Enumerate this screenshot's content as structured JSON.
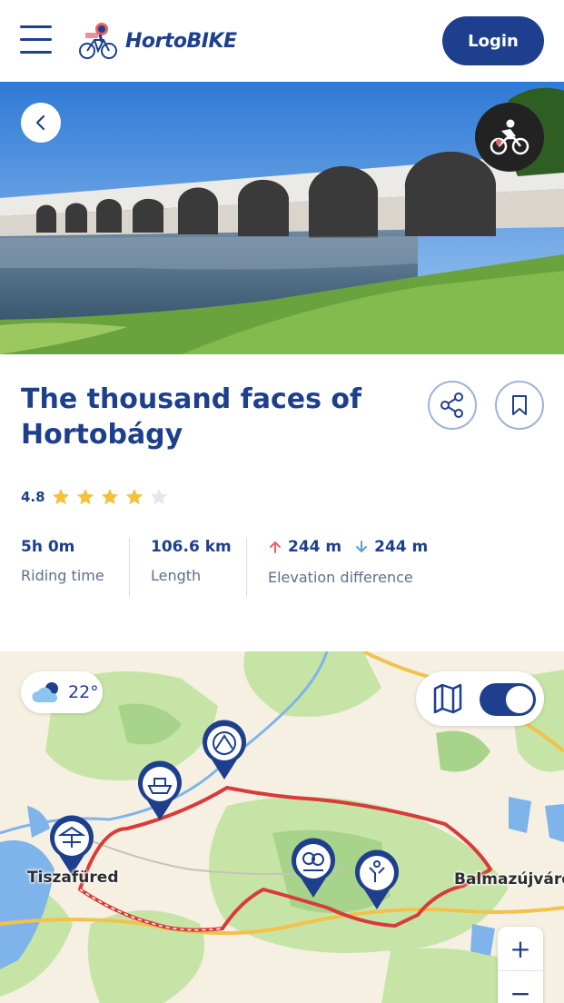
{
  "header": {
    "brand": "HortoBIKE",
    "login_label": "Login"
  },
  "tour": {
    "title": "The thousand faces of Hortobágy",
    "rating": "4.8",
    "rating_stars": 4,
    "rating_max": 5
  },
  "stats": {
    "riding_time_value": "5h 0m",
    "riding_time_label": "Riding time",
    "length_value": "106.6 km",
    "length_label": "Length",
    "elevation_up": "244 m",
    "elevation_down": "244 m",
    "elevation_label": "Elevation difference"
  },
  "map": {
    "temperature": "22°",
    "town_left": "Tiszafüred",
    "town_right": "Balmazújváros",
    "zoom_in": "+",
    "zoom_out": "−"
  },
  "colors": {
    "brand_blue": "#1d3f8e",
    "route_red": "#d93a3a",
    "star_gold": "#f3c13a",
    "elevation_up": "#e8606a",
    "elevation_down": "#5a9bd5"
  },
  "icons": {
    "menu": "hamburger-icon",
    "back": "chevron-left-icon",
    "bike_type": "cyclist-icon",
    "share": "share-icon",
    "bookmark": "bookmark-icon",
    "weather": "partly-cloudy-icon",
    "layers": "map-layers-icon"
  }
}
